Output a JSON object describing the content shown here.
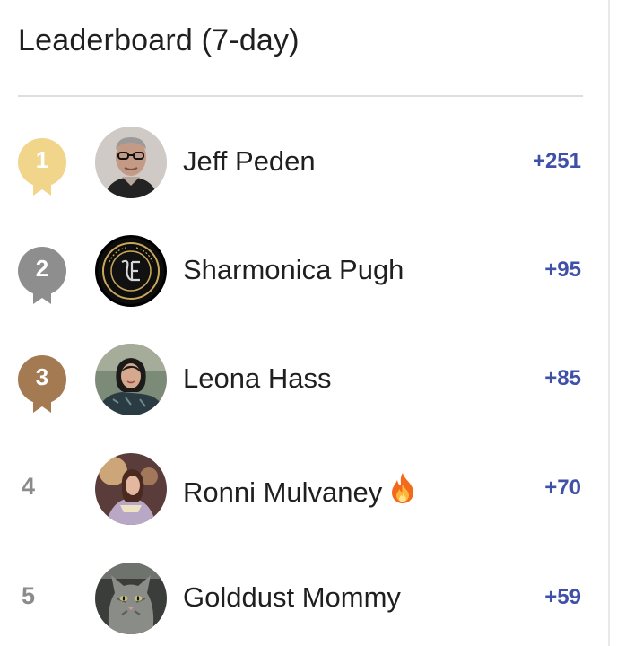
{
  "header": {
    "title": "Leaderboard (7-day)"
  },
  "colors": {
    "gold": "#f0d58a",
    "silver": "#8e8e8e",
    "bronze": "#a47a52",
    "score": "#3f50a8",
    "plain_rank": "#8b8b8b"
  },
  "leaders": [
    {
      "rank": "1",
      "medal": "gold",
      "name": "Jeff Peden",
      "score": "+251",
      "avatar_icon": "man-with-glasses-avatar"
    },
    {
      "rank": "2",
      "medal": "silver",
      "name": "Sharmonica Pugh",
      "score": "+95",
      "avatar_icon": "gilded-empress-logo-avatar"
    },
    {
      "rank": "3",
      "medal": "bronze",
      "name": "Leona Hass",
      "score": "+85",
      "avatar_icon": "woman-portrait-avatar"
    },
    {
      "rank": "4",
      "medal": "none",
      "name": "Ronni Mulvaney",
      "score": "+70",
      "avatar_icon": "fantasy-reader-avatar",
      "badge_icon": "fire-icon"
    },
    {
      "rank": "5",
      "medal": "none",
      "name": "Golddust Mommy",
      "score": "+59",
      "avatar_icon": "cat-avatar"
    }
  ]
}
